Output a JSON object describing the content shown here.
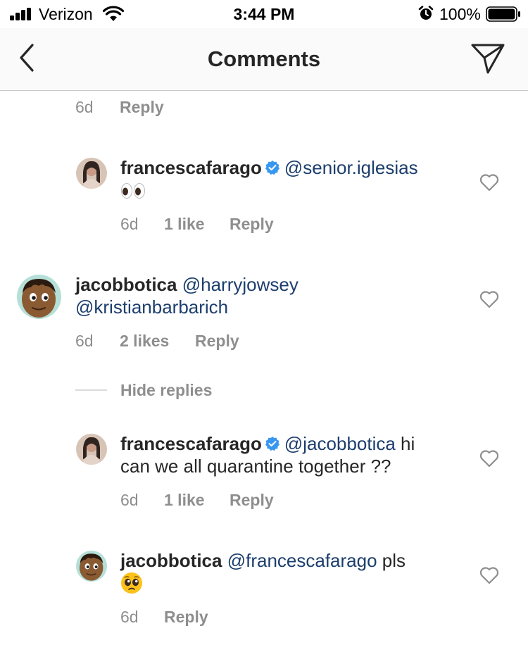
{
  "status_bar": {
    "carrier": "Verizon",
    "time": "3:44 PM",
    "battery": "100%",
    "icons": [
      "signal-icon",
      "wifi-icon",
      "alarm-icon",
      "battery-icon"
    ]
  },
  "nav": {
    "title": "Comments",
    "back_icon": "chevron-left-icon",
    "share_icon": "paper-plane-icon"
  },
  "top_meta": {
    "time": "6d",
    "reply": "Reply"
  },
  "comments": [
    {
      "username": "francescafarago",
      "verified": true,
      "mention": "@senior.iglesias",
      "text": "",
      "emoji": "eyes-emoji",
      "time": "6d",
      "likes": "1 like",
      "reply": "Reply"
    },
    {
      "username": "jacobbotica",
      "verified": false,
      "mention": "@harryjowsey",
      "mention2": "@kristianbarbarich",
      "time": "6d",
      "likes": "2 likes",
      "reply": "Reply"
    },
    {
      "username": "francescafarago",
      "verified": true,
      "mention": "@jacobbotica",
      "text": " hi",
      "text_line2": "can we all quarantine together ??",
      "time": "6d",
      "likes": "1 like",
      "reply": "Reply"
    },
    {
      "username": "jacobbotica",
      "verified": false,
      "mention": "@francescafarago",
      "text": " pls",
      "emoji": "pleading-face-emoji",
      "time": "6d",
      "reply": "Reply"
    }
  ],
  "hide_replies": "Hide replies",
  "colors": {
    "mention": "#1c3e6d",
    "muted": "#8e8e8e",
    "verified": "#3897f0"
  }
}
